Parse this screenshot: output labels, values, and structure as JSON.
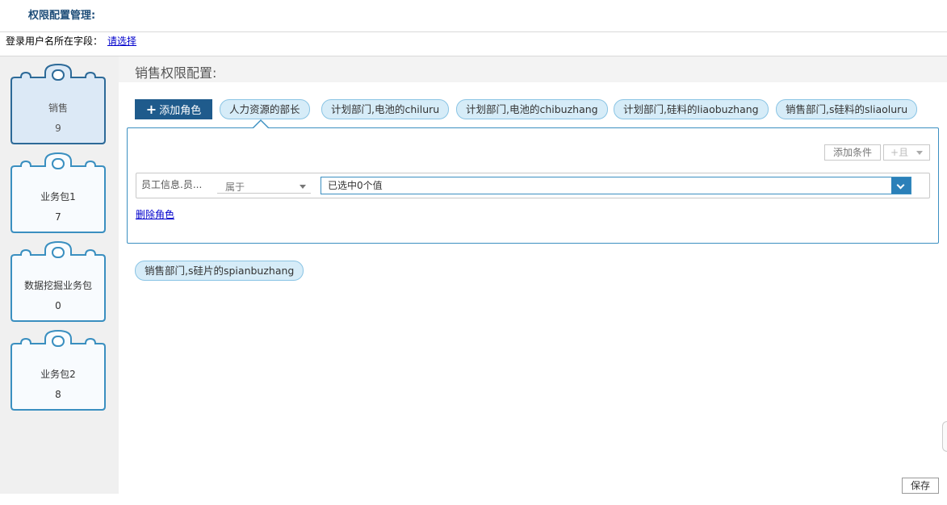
{
  "title": "权限配置管理:",
  "login_field": {
    "label": "登录用户名所在字段：",
    "link": "请选择"
  },
  "packages": [
    {
      "name": "销售",
      "count": "9",
      "selected": true
    },
    {
      "name": "业务包1",
      "count": "7",
      "selected": false
    },
    {
      "name": "数据挖掘业务包",
      "count": "0",
      "selected": false
    },
    {
      "name": "业务包2",
      "count": "8",
      "selected": false
    }
  ],
  "main": {
    "header": "销售权限配置:",
    "add_role_label": "添加角色",
    "roles": [
      "人力资源的部长",
      "计划部门,电池的chiluru",
      "计划部门,电池的chibuzhang",
      "计划部门,硅料的liaobuzhang",
      "销售部门,s硅料的sliaoluru"
    ],
    "roles_row2": [
      "销售部门,s硅片的spianbuzhang"
    ],
    "panel": {
      "add_condition": "添加条件",
      "and_label": "+且",
      "field_label": "员工信息.员...",
      "operator": "属于",
      "value_placeholder": "已选中0个值",
      "delete_role": "删除角色"
    }
  },
  "save_label": "保存",
  "colors": {
    "accent": "#1f5b8c",
    "pill_bg": "#d6ecf8",
    "panel_border": "#3b8fc1",
    "sidebar_bg": "#f0f0f0",
    "pkg_stroke": "#3a8fc0",
    "pkg_selected_fill": "#dce9f6"
  }
}
